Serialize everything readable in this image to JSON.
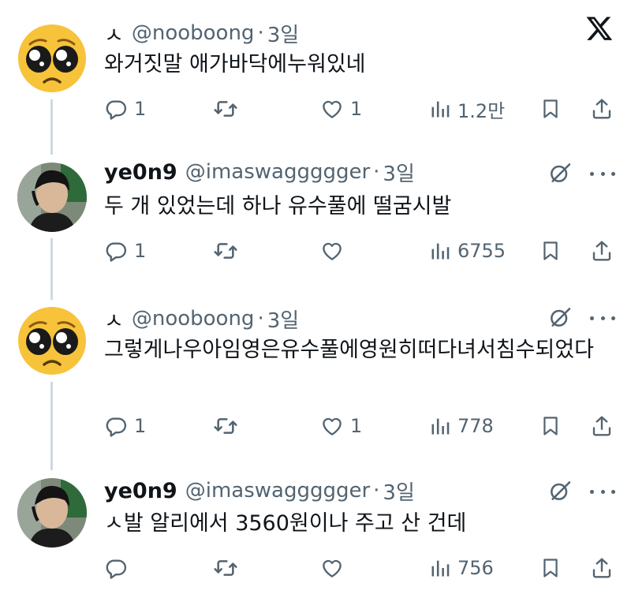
{
  "tweets": [
    {
      "name": "ㅅ",
      "handle": "@nooboong",
      "time": "3일",
      "text": "와거짓말 애가바닥에누워있네",
      "replies": "1",
      "retweets": "",
      "likes": "1",
      "views": "1.2만"
    },
    {
      "name": "ye0n9",
      "handle": "@imaswaggggger",
      "time": "3일",
      "text": "두 개 있었는데 하나 유수풀에 떨굼시발",
      "replies": "1",
      "retweets": "",
      "likes": "",
      "views": "6755"
    },
    {
      "name": "ㅅ",
      "handle": "@nooboong",
      "time": "3일",
      "text": "그렇게나우아임영은유수풀에영원히떠다녀서침수되었다",
      "replies": "1",
      "retweets": "",
      "likes": "1",
      "views": "778"
    },
    {
      "name": "ye0n9",
      "handle": "@imaswaggggger",
      "time": "3일",
      "text": "ㅅ발 알리에서 3560원이나 주고 산 건데",
      "replies": "",
      "retweets": "",
      "likes": "",
      "views": "756"
    }
  ],
  "icons": {
    "brand": "x-logo-icon",
    "grok": "grok-icon",
    "more": "more-dots-icon"
  },
  "colors": {
    "text": "#0f1419",
    "secondary": "#536471",
    "thread_line": "#cfd9de",
    "emoji_face": "#f7c33a"
  }
}
